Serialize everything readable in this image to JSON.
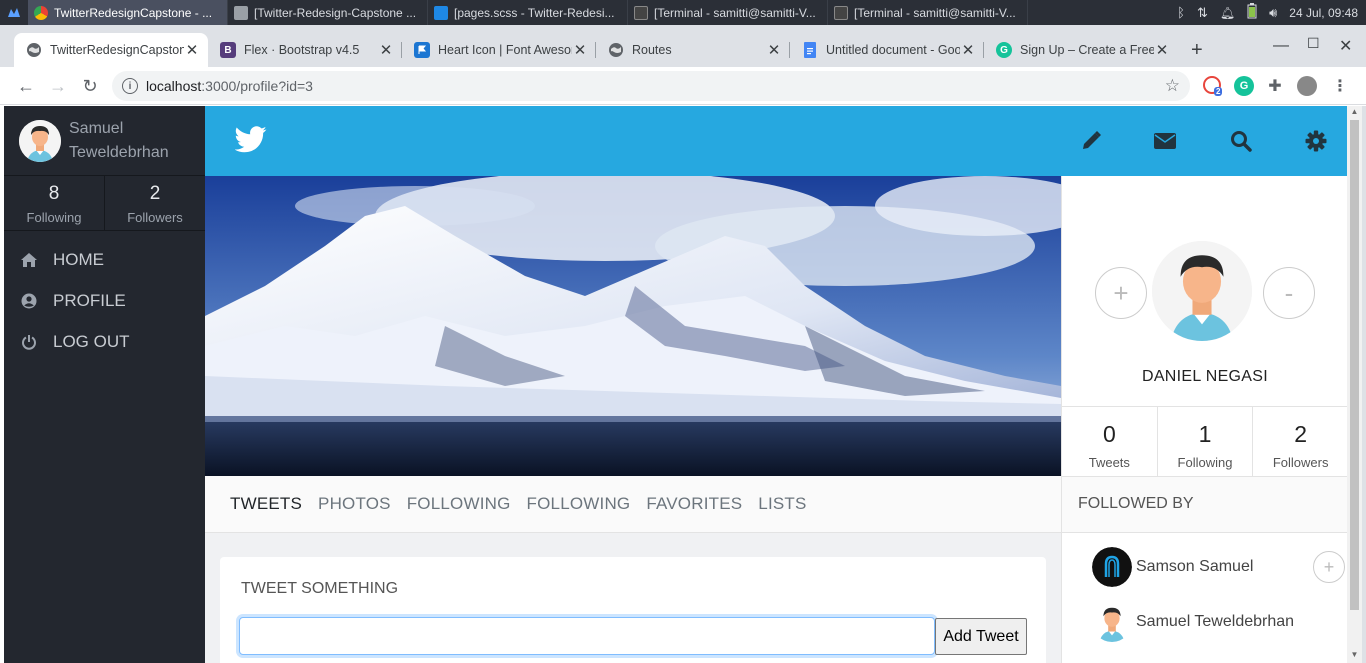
{
  "taskbar": {
    "windows": [
      {
        "label": "TwitterRedesignCapstone - ...",
        "active": true,
        "color": "#4285f4"
      },
      {
        "label": "[Twitter-Redesign-Capstone ...",
        "active": false,
        "color": "#9aa0a6"
      },
      {
        "label": "[pages.scss - Twitter-Redesi...",
        "active": false,
        "color": "#1e88e5"
      },
      {
        "label": "[Terminal - samitti@samitti-V...",
        "active": false,
        "color": "#555"
      },
      {
        "label": "[Terminal - samitti@samitti-V...",
        "active": false,
        "color": "#555"
      }
    ],
    "clock": "24 Jul, 09:48"
  },
  "browser": {
    "tabs": [
      {
        "title": "TwitterRedesignCapstone",
        "favicon_color": "#5f6368",
        "favicon": "globe-icon",
        "active": true
      },
      {
        "title": "Flex · Bootstrap v4.5",
        "favicon_color": "#563d7c",
        "favicon": "B",
        "active": false
      },
      {
        "title": "Heart Icon | Font Awesome",
        "favicon_color": "#1c76d2",
        "favicon": "flag-icon",
        "active": false
      },
      {
        "title": "Routes",
        "favicon_color": "#5f6368",
        "favicon": "globe-icon",
        "active": false
      },
      {
        "title": "Untitled document - Google Docs",
        "favicon_color": "#4285f4",
        "favicon": "doc-icon",
        "active": false
      },
      {
        "title": "Sign Up – Create a Free Account",
        "favicon_color": "#15c39a",
        "favicon": "G",
        "active": false
      }
    ],
    "url_host": "localhost",
    "url_path": ":3000/profile?id=3",
    "extension_badge": "2"
  },
  "sidebar": {
    "user_first": "Samuel",
    "user_last": "Teweldebrhan",
    "following_count": "8",
    "following_label": "Following",
    "followers_count": "2",
    "followers_label": "Followers",
    "nav": [
      {
        "label": "HOME",
        "icon": "home-icon"
      },
      {
        "label": "PROFILE",
        "icon": "user-icon"
      },
      {
        "label": "LOG OUT",
        "icon": "power-icon"
      }
    ]
  },
  "header": {
    "brand_color": "#26a8e0",
    "icons": [
      "pencil-icon",
      "envelope-icon",
      "search-icon",
      "gear-icon"
    ]
  },
  "profile_tabs": [
    "TWEETS",
    "PHOTOS",
    "FOLLOWING",
    "FOLLOWING",
    "FAVORITES",
    "LISTS"
  ],
  "tweet_box": {
    "title": "TWEET SOMETHING",
    "input_value": "",
    "button_label": "Add Tweet"
  },
  "profile": {
    "plus_label": "+",
    "minus_label": "-",
    "name": "DANIEL NEGASI",
    "stats": [
      {
        "value": "0",
        "label": "Tweets"
      },
      {
        "value": "1",
        "label": "Following"
      },
      {
        "value": "2",
        "label": "Followers"
      }
    ],
    "followed_by_title": "FOLLOWED BY",
    "followed_by": [
      {
        "name": "Samson Samuel",
        "show_follow": true
      },
      {
        "name": "Samuel Teweldebrhan",
        "show_follow": false
      }
    ],
    "follow_plus": "+"
  }
}
